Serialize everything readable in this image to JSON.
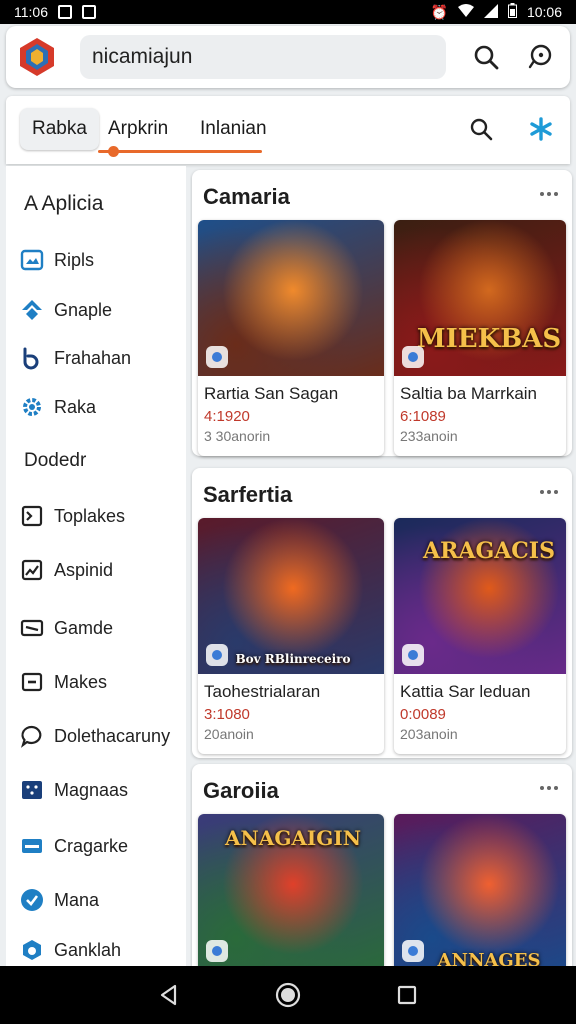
{
  "status_bar": {
    "left_text": "11:06",
    "right_text": "10:06"
  },
  "search": {
    "value": "nicamiajun"
  },
  "tabs": [
    {
      "label": "Rabka",
      "active": true
    },
    {
      "label": "Arpkrin",
      "active": false
    },
    {
      "label": "Inlanian",
      "active": false
    }
  ],
  "sidebar": {
    "heading": "A Aplicia",
    "subheading": "Dodedr",
    "items_top": [
      {
        "label": "Ripls",
        "icon": "image-icon"
      },
      {
        "label": "Gnaple",
        "icon": "sprout-icon"
      },
      {
        "label": "Frahahan",
        "icon": "b-logo-icon"
      },
      {
        "label": "Raka",
        "icon": "gear-icon"
      }
    ],
    "items_bottom": [
      {
        "label": "Toplakes",
        "icon": "toolbox-icon"
      },
      {
        "label": "Aspinid",
        "icon": "photo-icon"
      },
      {
        "label": "Gamde",
        "icon": "card-icon"
      },
      {
        "label": "Makes",
        "icon": "minus-box-icon"
      },
      {
        "label": "Dolethacaruny",
        "icon": "chat-bubble-icon"
      },
      {
        "label": "Magnaas",
        "icon": "grid-box-icon"
      },
      {
        "label": "Cragarke",
        "icon": "tray-icon"
      },
      {
        "label": "Mana",
        "icon": "check-circle-icon"
      },
      {
        "label": "Ganklah",
        "icon": "cloud-icon"
      }
    ]
  },
  "sections": [
    {
      "title": "Camaria",
      "cards": [
        {
          "title": "Rartia San Sagan",
          "price": "4:1920",
          "sub": "3 30anorin",
          "thumb_text": "",
          "palette": [
            "#1e4f8a",
            "#f08a2c",
            "#6a2c1a"
          ]
        },
        {
          "title": "Saltia ba Marrkain",
          "price": "6:1089",
          "sub": "233anoin",
          "thumb_text": "MIEKBAS",
          "palette": [
            "#3a1f12",
            "#d2691e",
            "#8b1a1a"
          ]
        }
      ]
    },
    {
      "title": "Sarfertia",
      "cards": [
        {
          "title": "Taohestrialaran",
          "price": "3:1080",
          "sub": "20anoin",
          "thumb_text": "Bov RBlinreceiro",
          "palette": [
            "#5a1a2a",
            "#f06a20",
            "#2a3a6a"
          ]
        },
        {
          "title": "Kattia Sar leduan",
          "price": "0:0089",
          "sub": "203anoin",
          "thumb_text": "ARAGACIS",
          "palette": [
            "#1a2a5a",
            "#e05a1a",
            "#6a2a8a"
          ]
        }
      ]
    },
    {
      "title": "Garoiia",
      "cards": [
        {
          "title": "",
          "price": "",
          "sub": "",
          "thumb_text": "ANAGAIGIN",
          "palette": [
            "#3a3a7a",
            "#e0402a",
            "#2a6a3a"
          ]
        },
        {
          "title": "",
          "price": "",
          "sub": "",
          "thumb_text": "ANNAGES",
          "palette": [
            "#5a1a5a",
            "#f06030",
            "#1a4a8a"
          ]
        }
      ]
    }
  ],
  "colors": {
    "accent": "#e8692a",
    "icon_blue": "#1f7fc4",
    "price_red": "#c0392b"
  }
}
